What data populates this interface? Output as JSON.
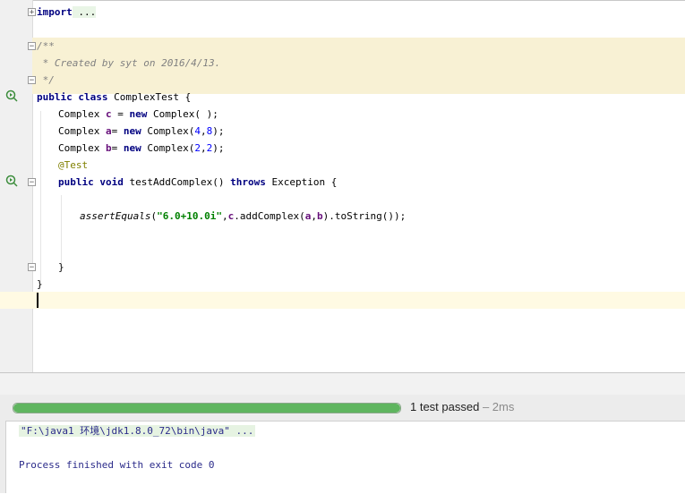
{
  "editor": {
    "import_line": {
      "keyword": "import",
      "folded": " ..."
    },
    "comment": {
      "open": "/**",
      "body": " * Created by syt on 2016/4/13.",
      "close": " */"
    },
    "class_decl": {
      "kw1": "public",
      "kw2": "class",
      "name": " ComplexTest {"
    },
    "field_c": {
      "type": "Complex ",
      "var": "c",
      "eq": " = ",
      "kw": "new",
      "rest": " Complex( );"
    },
    "field_a": {
      "type": "Complex ",
      "var": "a",
      "eq": "= ",
      "kw": "new",
      "ctor": " Complex(",
      "n1": "4",
      "comma": ",",
      "n2": "8",
      "end": ");"
    },
    "field_b": {
      "type": "Complex ",
      "var": "b",
      "eq": "= ",
      "kw": "new",
      "ctor": " Complex(",
      "n1": "2",
      "comma": ",",
      "n2": "2",
      "end": ");"
    },
    "annotation": "@Test",
    "method_decl": {
      "kw1": "public",
      "kw2": "void",
      "name": " testAddComplex() ",
      "kw3": "throws",
      "rest": " Exception {"
    },
    "assert_line": {
      "fn": "assertEquals",
      "open": "(",
      "str": "\"6.0+10.0i\"",
      "sep": ",",
      "c": "c",
      "call": ".addComplex(",
      "a": "a",
      "comma": ",",
      "b": "b",
      "end": ").toString());"
    },
    "close_method": "}",
    "close_class": "}"
  },
  "test_runner": {
    "progress_percent": 100,
    "status": "1 test passed",
    "time": " – 2ms",
    "colors": {
      "passed": "#5fb55f"
    }
  },
  "console": {
    "command": "\"F:\\java1 环境\\jdk1.8.0_72\\bin\\java\" ...",
    "exit": "Process finished with exit code 0"
  },
  "icons": [
    "run-test-icon",
    "fold-icon"
  ]
}
